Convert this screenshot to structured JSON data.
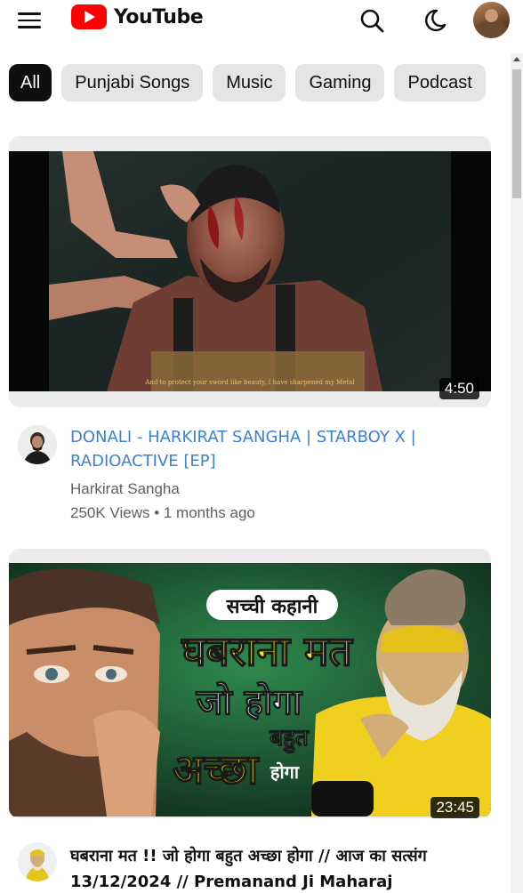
{
  "header": {
    "logo_text": "YouTube",
    "menu_icon": "hamburger-menu-icon",
    "search_icon": "search-icon",
    "theme_icon": "moon-icon",
    "avatar": "user-avatar"
  },
  "chips": [
    "All",
    "Punjabi Songs",
    "Music",
    "Gaming",
    "Podcast"
  ],
  "videos": [
    {
      "title": "DONALI - HARKIRAT SANGHA | STARBOY X | RADIOACTIVE [EP]",
      "channel": "Harkirat Sangha",
      "stats": "250K Views • 1 months ago",
      "duration": "4:50",
      "subtitle_text": "And to protect your sword like beauty, I have sharpened my Metal"
    },
    {
      "title": "घबराना मत !! जो होगा बहुत अच्छा होगा // आज का सत्संग 13/12/2024 // Premanand Ji Maharaj",
      "duration": "23:45",
      "thumb_banner": "सच्ची कहानी",
      "thumb_line1": "घबराना मत",
      "thumb_line2": "जो होगा",
      "thumb_line3": "बहुत",
      "thumb_line4": "अच्छा",
      "thumb_line5": "होगा"
    }
  ],
  "colors": {
    "brand_red": "#ff0000",
    "title_blue": "#3e80d8",
    "chip_bg": "#e5e5e5",
    "chip_active_bg": "#0f0f0f"
  }
}
